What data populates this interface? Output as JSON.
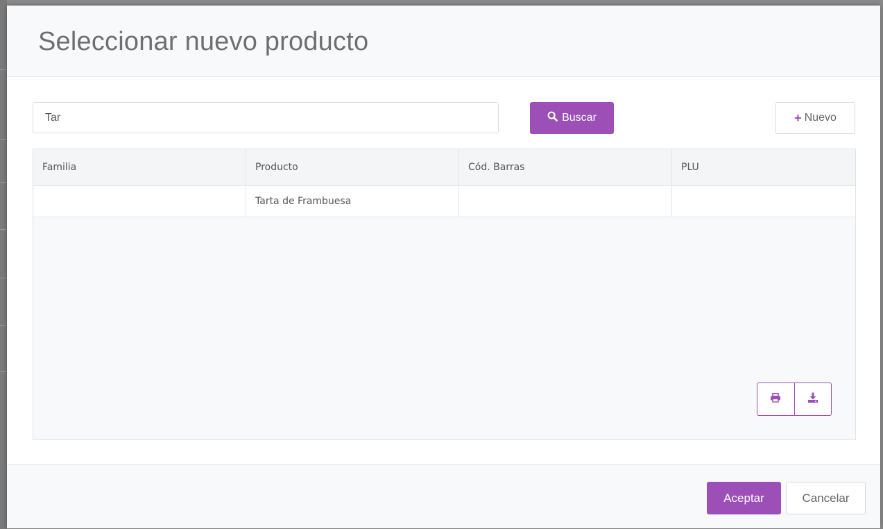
{
  "modal": {
    "title": "Seleccionar nuevo producto"
  },
  "search": {
    "value": "Tar",
    "button_label": "Buscar",
    "search_icon": "search-icon"
  },
  "toolbar": {
    "new_label": "Nuevo",
    "new_icon": "plus-icon"
  },
  "table": {
    "columns": [
      "Familia",
      "Producto",
      "Cód. Barras",
      "PLU"
    ],
    "rows": [
      [
        "",
        "Tarta de Frambuesa",
        "",
        ""
      ]
    ]
  },
  "table_actions": {
    "print_icon": "print-icon",
    "export_icon": "download-icon"
  },
  "footer": {
    "accept_label": "Aceptar",
    "cancel_label": "Cancelar"
  },
  "colors": {
    "accent": "#9b4fb7",
    "background": "#f8f9fa"
  }
}
